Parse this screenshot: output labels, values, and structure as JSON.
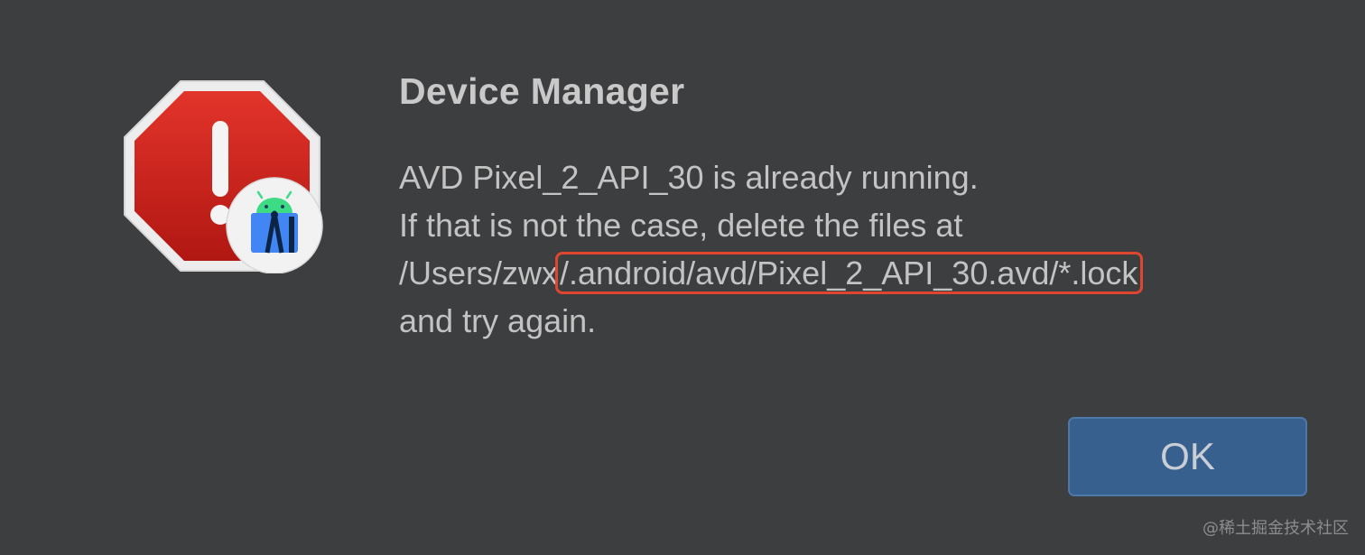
{
  "dialog": {
    "title": "Device Manager",
    "message_lines": [
      "AVD Pixel_2_API_30 is already running.",
      "If that is not the case, delete the files at"
    ],
    "path_prefix": "/Users/zwx",
    "path_highlight": "/.android/avd/Pixel_2_API_30.avd/*.lock",
    "message_end": "and try again.",
    "ok_label": "OK",
    "icons": {
      "alert": "stop-sign-exclamation-icon",
      "app_badge": "android-studio-icon"
    },
    "colors": {
      "background": "#3d3e40",
      "stop_sign": "#c8201a",
      "highlight_border": "#e0462f",
      "button": "#37608f"
    }
  },
  "watermark": "@稀土掘金技术社区"
}
